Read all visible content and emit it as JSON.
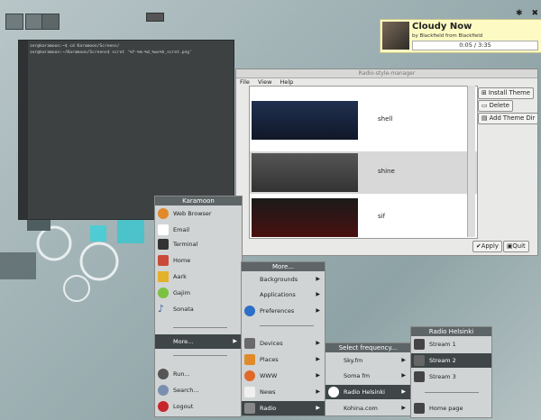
{
  "now_playing": {
    "title": "Cloudy Now",
    "subtitle": "by Blackfield from Blackfield",
    "progress": "0:05 / 3:35"
  },
  "terminal": {
    "side_label": "zer@karamoon:~/Karamoon",
    "lines": [
      "zer@karamoon:~$ cd Karamoon/Screens/",
      "zer@karamoon:~/Karamoon/Screens$ scrot '%Y-%m-%d_%wx%h_scrot.png' "
    ]
  },
  "radio_manager": {
    "title": "Radio-style-manager",
    "menu": [
      "File",
      "View",
      "Help"
    ],
    "rows": [
      {
        "label": "shell"
      },
      {
        "label": "shine"
      },
      {
        "label": "sif"
      }
    ],
    "buttons": {
      "install": "Install Theme",
      "delete": "Delete",
      "add_dir": "Add Theme Dir",
      "apply": "Apply",
      "quit": "Quit"
    }
  },
  "menu_main": {
    "title": "Karamoon",
    "items": [
      "Web Browser",
      "Email",
      "Terminal",
      "Home",
      "Aark",
      "Gajim",
      "Sonata",
      "More...",
      "Run...",
      "Search...",
      "Logout"
    ]
  },
  "menu_more": {
    "title": "More...",
    "items": [
      "Backgrounds",
      "Applications",
      "Preferences",
      "Devices",
      "Places",
      "WWW",
      "News",
      "Radio"
    ]
  },
  "menu_freq": {
    "title": "Select frequency...",
    "items": [
      "Sky.fm",
      "Soma fm",
      "Radio Helsinki",
      "Kohina.com"
    ]
  },
  "menu_radio": {
    "title": "Radio Helsinki",
    "items": [
      "Stream 1",
      "Stream 2",
      "Stream 3",
      "Home page"
    ]
  }
}
